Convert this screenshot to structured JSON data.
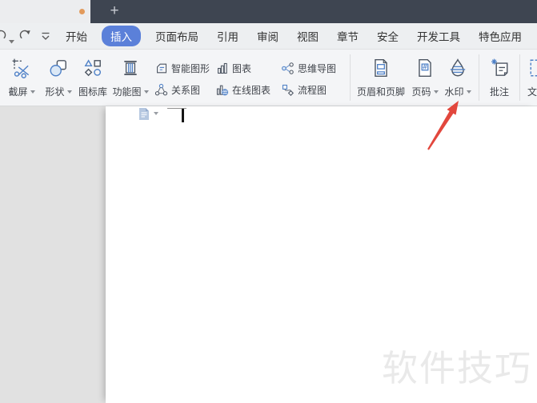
{
  "colors": {
    "accent_blue": "#5b80d9",
    "tab_bar_dark": "#3e4551",
    "modified_dot_orange": "#e29a5b",
    "annotation_arrow_red": "#e2473d",
    "watermark_gray": "#e9e9e9"
  },
  "tab_bar": {
    "new_tab_label": "+"
  },
  "quick_access": {
    "items": [
      {
        "icon": "undo-icon"
      },
      {
        "icon": "redo-icon"
      },
      {
        "icon": "customize-toolbar-icon"
      }
    ]
  },
  "menu": {
    "tabs": [
      {
        "label": "开始",
        "active": false
      },
      {
        "label": "插入",
        "active": true
      },
      {
        "label": "页面布局",
        "active": false
      },
      {
        "label": "引用",
        "active": false
      },
      {
        "label": "审阅",
        "active": false
      },
      {
        "label": "视图",
        "active": false
      },
      {
        "label": "章节",
        "active": false
      },
      {
        "label": "安全",
        "active": false
      },
      {
        "label": "开发工具",
        "active": false
      },
      {
        "label": "特色应用",
        "active": false
      }
    ]
  },
  "ribbon": {
    "large_left": [
      {
        "label": "截屏",
        "icon": "screenshot-icon",
        "dropdown": true
      },
      {
        "label": "形状",
        "icon": "shapes-icon",
        "dropdown": true
      },
      {
        "label": "图标库",
        "icon": "icon-library-icon",
        "dropdown": false
      },
      {
        "label": "功能图",
        "icon": "function-diagram-icon",
        "dropdown": true
      }
    ],
    "small_row1": [
      {
        "label": "智能图形",
        "icon": "smartart-icon"
      },
      {
        "label": "图表",
        "icon": "chart-icon"
      },
      {
        "label": "思维导图",
        "icon": "mindmap-icon"
      }
    ],
    "small_row2": [
      {
        "label": "关系图",
        "icon": "relation-diagram-icon"
      },
      {
        "label": "在线图表",
        "icon": "online-chart-icon"
      },
      {
        "label": "流程图",
        "icon": "flowchart-icon"
      }
    ],
    "large_right": [
      {
        "label": "页眉和页脚",
        "icon": "header-footer-icon",
        "dropdown": false
      },
      {
        "label": "页码",
        "icon": "page-number-icon",
        "dropdown": true
      },
      {
        "label": "水印",
        "icon": "watermark-icon",
        "dropdown": true
      }
    ],
    "comment": {
      "label": "批注",
      "icon": "comment-icon"
    },
    "partial": {
      "label": "文",
      "icon": "text-tool-icon"
    }
  },
  "document": {
    "watermark_text": "软件技巧"
  }
}
